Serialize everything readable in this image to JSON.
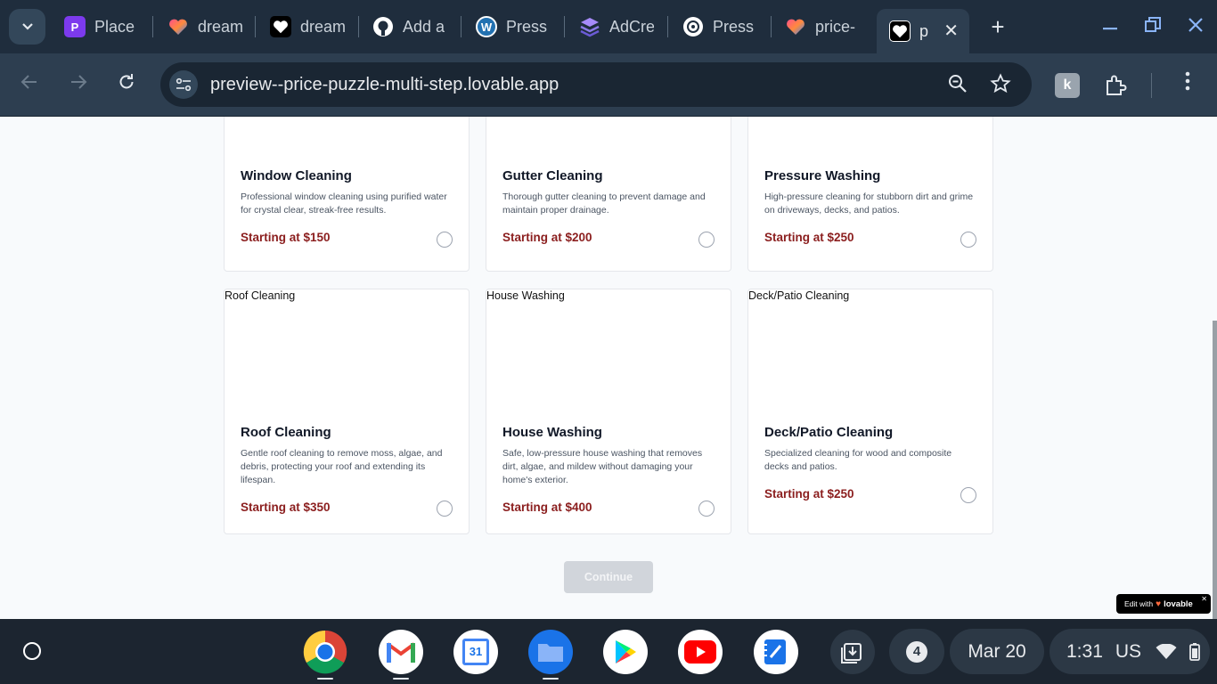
{
  "browser": {
    "tabs": [
      {
        "title": "Place",
        "favicon": "letter-p-icon",
        "favicon_color": "#7c3aed",
        "favicon_text": "P"
      },
      {
        "title": "dream",
        "favicon": "lovable-heart-icon",
        "favicon_color": "#ff6a3d"
      },
      {
        "title": "dream",
        "favicon": "white-heart-icon",
        "favicon_color": "#000000"
      },
      {
        "title": "Add a",
        "favicon": "github-icon",
        "favicon_color": "#ffffff"
      },
      {
        "title": "Press",
        "favicon": "wordpress-icon",
        "favicon_color": "#2271b1",
        "favicon_text": "W"
      },
      {
        "title": "AdCre",
        "favicon": "adcreative-icon",
        "favicon_color": "#6b5bd6"
      },
      {
        "title": "Press",
        "favicon": "openai-icon",
        "favicon_color": "#ffffff"
      },
      {
        "title": "price-",
        "favicon": "lovable-heart-icon",
        "favicon_color": "#ff6a3d"
      },
      {
        "title": "p",
        "favicon": "white-heart-icon",
        "favicon_color": "#000000",
        "active": true
      }
    ],
    "url": "preview--price-puzzle-multi-step.lovable.app"
  },
  "services": [
    {
      "title": "Window Cleaning",
      "description": "Professional window cleaning using purified water for crystal clear, streak-free results.",
      "price": "Starting at $150",
      "image_alt": ""
    },
    {
      "title": "Gutter Cleaning",
      "description": "Thorough gutter cleaning to prevent damage and maintain proper drainage.",
      "price": "Starting at $200",
      "image_alt": ""
    },
    {
      "title": "Pressure Washing",
      "description": "High-pressure cleaning for stubborn dirt and grime on driveways, decks, and patios.",
      "price": "Starting at $250",
      "image_alt": ""
    },
    {
      "title": "Roof Cleaning",
      "description": "Gentle roof cleaning to remove moss, algae, and debris, protecting your roof and extending its lifespan.",
      "price": "Starting at $350",
      "image_alt": "Roof Cleaning"
    },
    {
      "title": "House Washing",
      "description": "Safe, low-pressure house washing that removes dirt, algae, and mildew without damaging your home's exterior.",
      "price": "Starting at $400",
      "image_alt": "House Washing"
    },
    {
      "title": "Deck/Patio Cleaning",
      "description": "Specialized cleaning for wood and composite decks and patios.",
      "price": "Starting at $250",
      "image_alt": "Deck/Patio Cleaning"
    }
  ],
  "continue_label": "Continue",
  "badge": {
    "prefix": "Edit with",
    "brand": "lovable"
  },
  "shelf": {
    "apps": [
      "chrome-icon",
      "gmail-icon",
      "calendar-icon",
      "files-icon",
      "play-store-icon",
      "youtube-icon",
      "notes-icon"
    ],
    "calendar_day": "31",
    "notification_count": "4",
    "date": "Mar 20",
    "time": "1:31",
    "locale": "US"
  },
  "colors": {
    "price": "#8b1e1e",
    "continue_disabled": "#d1d5db",
    "shelf": "#1c2530",
    "toolbar": "#2d3e50"
  }
}
